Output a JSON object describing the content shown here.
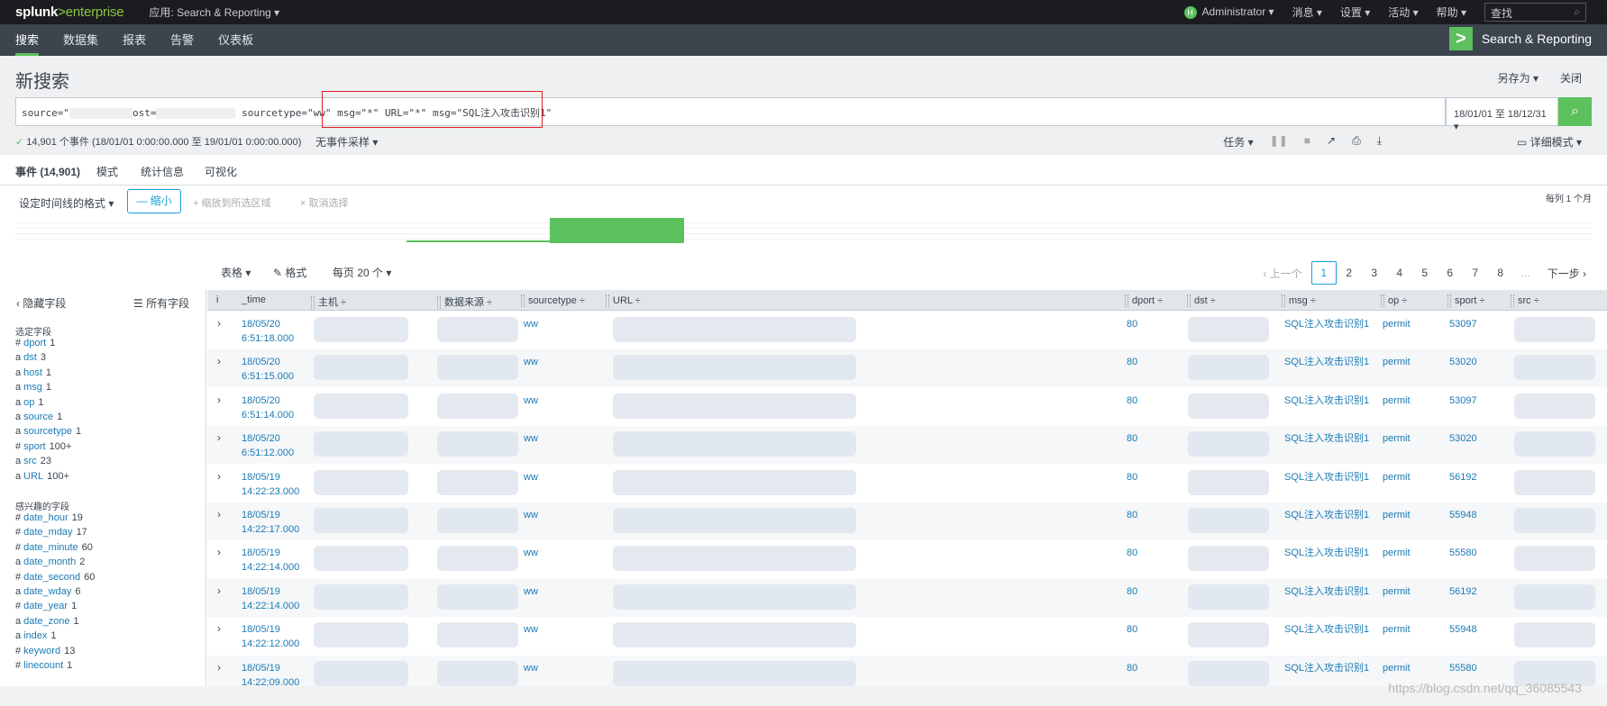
{
  "topbar": {
    "logo_main": "splunk",
    "logo_gt": ">",
    "logo_sub": "enterprise",
    "app_selector": "应用: Search & Reporting ▾",
    "user": "Administrator ▾",
    "avatar_letter": "H",
    "messages": "消息 ▾",
    "settings": "设置 ▾",
    "activity": "活动 ▾",
    "help": "帮助 ▾",
    "find_value": "查找"
  },
  "nav": {
    "tabs": [
      {
        "label": "搜索"
      },
      {
        "label": "数据集"
      },
      {
        "label": "报表"
      },
      {
        "label": "告警"
      },
      {
        "label": "仪表板"
      }
    ],
    "app_brand": "Search & Reporting"
  },
  "page": {
    "title": "新搜索",
    "save_as": "另存为 ▾",
    "close": "关闭"
  },
  "search": {
    "query_prefix": "source=\"",
    "query_host": "ost=",
    "query_main": "sourcetype=\"ww\" msg=\"*\" URL=\"*\" msg=\"SQL注入攻击识别1\"",
    "time_range": "18/01/01 至 18/12/31 ▾"
  },
  "status": {
    "events_text": "14,901 个事件 (18/01/01 0:00:00.000 至 19/01/01 0:00:00.000)",
    "sampling": "无事件采样 ▾",
    "job": "任务 ▾",
    "verbose": "详细模式 ▾"
  },
  "result_tabs": [
    {
      "label": "事件 (14,901)"
    },
    {
      "label": "模式"
    },
    {
      "label": "统计信息"
    },
    {
      "label": "可视化"
    }
  ],
  "timeline": {
    "format": "设定时间线的格式 ▾",
    "zoom_out": "— 缩小",
    "zoom_to_selection": "+ 缩放到所选区域",
    "deselect": "× 取消选择",
    "per_column": "每列 1 个月"
  },
  "table_controls": {
    "table": "表格 ▾",
    "format": "格式",
    "per_page": "每页 20 个 ▾",
    "prev": "‹ 上一个",
    "pages": [
      "1",
      "2",
      "3",
      "4",
      "5",
      "6",
      "7",
      "8"
    ],
    "ellipsis": "...",
    "next": "下一步 ›"
  },
  "sidebar": {
    "hide_fields": "隐藏字段",
    "all_fields": "所有字段",
    "selected_label": "选定字段",
    "selected_fields": [
      {
        "type": "#",
        "name": "dport",
        "count": "1"
      },
      {
        "type": "a",
        "name": "dst",
        "count": "3"
      },
      {
        "type": "a",
        "name": "host",
        "count": "1"
      },
      {
        "type": "a",
        "name": "msg",
        "count": "1"
      },
      {
        "type": "a",
        "name": "op",
        "count": "1"
      },
      {
        "type": "a",
        "name": "source",
        "count": "1"
      },
      {
        "type": "a",
        "name": "sourcetype",
        "count": "1"
      },
      {
        "type": "#",
        "name": "sport",
        "count": "100+"
      },
      {
        "type": "a",
        "name": "src",
        "count": "23"
      },
      {
        "type": "a",
        "name": "URL",
        "count": "100+"
      }
    ],
    "interesting_label": "感兴趣的字段",
    "interesting_fields": [
      {
        "type": "#",
        "name": "date_hour",
        "count": "19"
      },
      {
        "type": "#",
        "name": "date_mday",
        "count": "17"
      },
      {
        "type": "#",
        "name": "date_minute",
        "count": "60"
      },
      {
        "type": "a",
        "name": "date_month",
        "count": "2"
      },
      {
        "type": "#",
        "name": "date_second",
        "count": "60"
      },
      {
        "type": "a",
        "name": "date_wday",
        "count": "6"
      },
      {
        "type": "#",
        "name": "date_year",
        "count": "1"
      },
      {
        "type": "a",
        "name": "date_zone",
        "count": "1"
      },
      {
        "type": "a",
        "name": "index",
        "count": "1"
      },
      {
        "type": "#",
        "name": "keyword",
        "count": "13"
      },
      {
        "type": "#",
        "name": "linecount",
        "count": "1"
      }
    ]
  },
  "table": {
    "headers": [
      {
        "label": "i"
      },
      {
        "label": "_time"
      },
      {
        "label": "主机 ÷"
      },
      {
        "label": "数据来源 ÷"
      },
      {
        "label": "sourcetype ÷"
      },
      {
        "label": "URL ÷"
      },
      {
        "label": "dport ÷"
      },
      {
        "label": "dst ÷"
      },
      {
        "label": "msg ÷"
      },
      {
        "label": "op ÷"
      },
      {
        "label": "sport ÷"
      },
      {
        "label": "src ÷"
      }
    ],
    "rows": [
      {
        "date": "18/05/20",
        "time": "6:51:18.000",
        "sourcetype": "ww",
        "dport": "80",
        "msg": "SQL注入攻击识别1",
        "op": "permit",
        "sport": "53097"
      },
      {
        "date": "18/05/20",
        "time": "6:51:15.000",
        "sourcetype": "ww",
        "dport": "80",
        "msg": "SQL注入攻击识别1",
        "op": "permit",
        "sport": "53020"
      },
      {
        "date": "18/05/20",
        "time": "6:51:14.000",
        "sourcetype": "ww",
        "dport": "80",
        "msg": "SQL注入攻击识别1",
        "op": "permit",
        "sport": "53097"
      },
      {
        "date": "18/05/20",
        "time": "6:51:12.000",
        "sourcetype": "ww",
        "dport": "80",
        "msg": "SQL注入攻击识别1",
        "op": "permit",
        "sport": "53020"
      },
      {
        "date": "18/05/19",
        "time": "14:22:23.000",
        "sourcetype": "ww",
        "dport": "80",
        "msg": "SQL注入攻击识别1",
        "op": "permit",
        "sport": "56192"
      },
      {
        "date": "18/05/19",
        "time": "14:22:17.000",
        "sourcetype": "ww",
        "dport": "80",
        "msg": "SQL注入攻击识别1",
        "op": "permit",
        "sport": "55948"
      },
      {
        "date": "18/05/19",
        "time": "14:22:14.000",
        "sourcetype": "ww",
        "dport": "80",
        "msg": "SQL注入攻击识别1",
        "op": "permit",
        "sport": "55580"
      },
      {
        "date": "18/05/19",
        "time": "14:22:14.000",
        "sourcetype": "ww",
        "dport": "80",
        "msg": "SQL注入攻击识别1",
        "op": "permit",
        "sport": "56192"
      },
      {
        "date": "18/05/19",
        "time": "14:22:12.000",
        "sourcetype": "ww",
        "dport": "80",
        "msg": "SQL注入攻击识别1",
        "op": "permit",
        "sport": "55948"
      },
      {
        "date": "18/05/19",
        "time": "14:22:09.000",
        "sourcetype": "ww",
        "dport": "80",
        "msg": "SQL注入攻击识别1",
        "op": "permit",
        "sport": "55580"
      }
    ]
  },
  "watermark": "https://blog.csdn.net/qq_36085543",
  "colors": {
    "accent_green": "#5cc05c",
    "link_blue": "#1a7ab4",
    "highlight_red": "#e02020"
  }
}
